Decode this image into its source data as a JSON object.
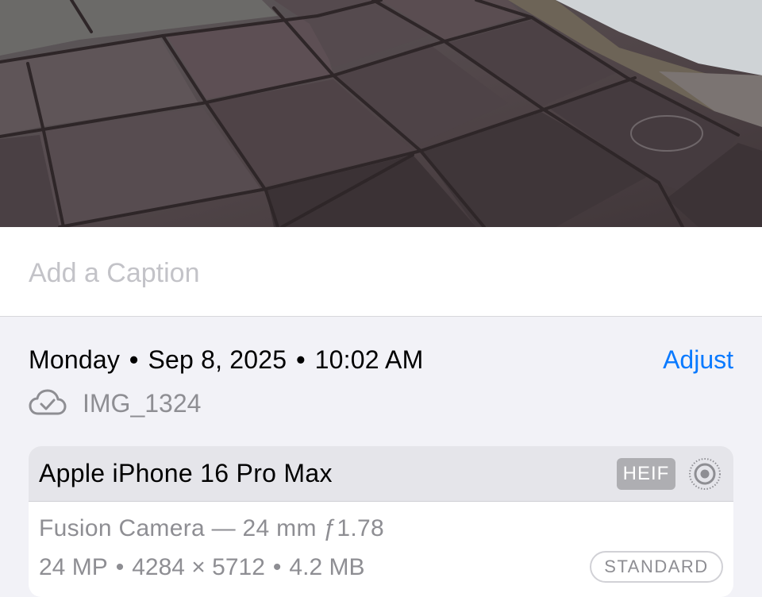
{
  "caption": {
    "placeholder": "Add a Caption",
    "value": ""
  },
  "metadata": {
    "day": "Monday",
    "date": "Sep 8, 2025",
    "time": "10:02 AM",
    "separator": "•",
    "adjust_label": "Adjust",
    "filename": "IMG_1324",
    "sync_icon": "cloud-check-icon"
  },
  "camera": {
    "device": "Apple iPhone 16 Pro Max",
    "format_badge": "HEIF",
    "live_icon": "live-photo-icon",
    "lens": "Fusion Camera — 24 mm ƒ1.78",
    "megapixels": "24 MP",
    "resolution": "4284 × 5712",
    "file_size": "4.2 MB",
    "dot": "•",
    "style_badge": "STANDARD"
  },
  "colors": {
    "accent": "#0a7aff",
    "background": "#f2f2f7",
    "secondary_text": "#8e8e93"
  }
}
